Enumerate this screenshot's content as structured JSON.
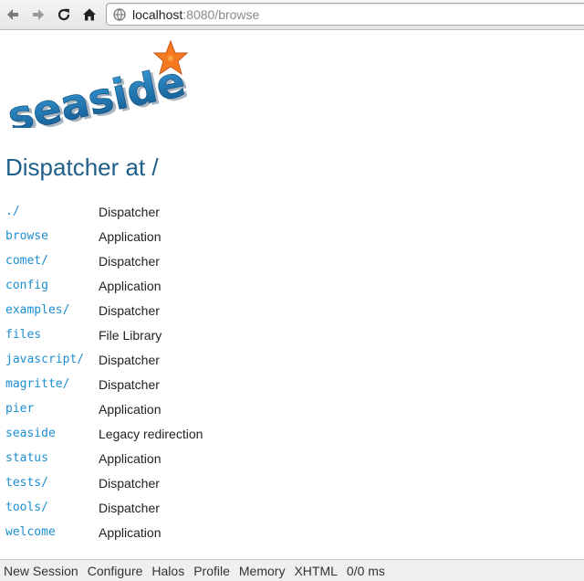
{
  "browser": {
    "url_host": "localhost",
    "url_rest": ":8080/browse"
  },
  "logo": {
    "text": "seaside",
    "text_color": "#1e6aa3",
    "star_color": "#f47b20"
  },
  "page": {
    "title": "Dispatcher at /"
  },
  "entries": [
    {
      "name": "./",
      "type": "Dispatcher"
    },
    {
      "name": "browse",
      "type": "Application"
    },
    {
      "name": "comet/",
      "type": "Dispatcher"
    },
    {
      "name": "config",
      "type": "Application"
    },
    {
      "name": "examples/",
      "type": "Dispatcher"
    },
    {
      "name": "files",
      "type": "File Library"
    },
    {
      "name": "javascript/",
      "type": "Dispatcher"
    },
    {
      "name": "magritte/",
      "type": "Dispatcher"
    },
    {
      "name": "pier",
      "type": "Application"
    },
    {
      "name": "seaside",
      "type": "Legacy redirection"
    },
    {
      "name": "status",
      "type": "Application"
    },
    {
      "name": "tests/",
      "type": "Dispatcher"
    },
    {
      "name": "tools/",
      "type": "Dispatcher"
    },
    {
      "name": "welcome",
      "type": "Application"
    }
  ],
  "footer": {
    "links": [
      "New Session",
      "Configure",
      "Halos",
      "Profile",
      "Memory",
      "XHTML"
    ],
    "timing": "0/0 ms"
  },
  "colors": {
    "link": "#1d8fd1",
    "title": "#1e5f8a"
  },
  "icons": [
    "back-arrow-icon",
    "forward-arrow-icon",
    "reload-icon",
    "home-icon",
    "globe-icon",
    "starfish-icon"
  ]
}
